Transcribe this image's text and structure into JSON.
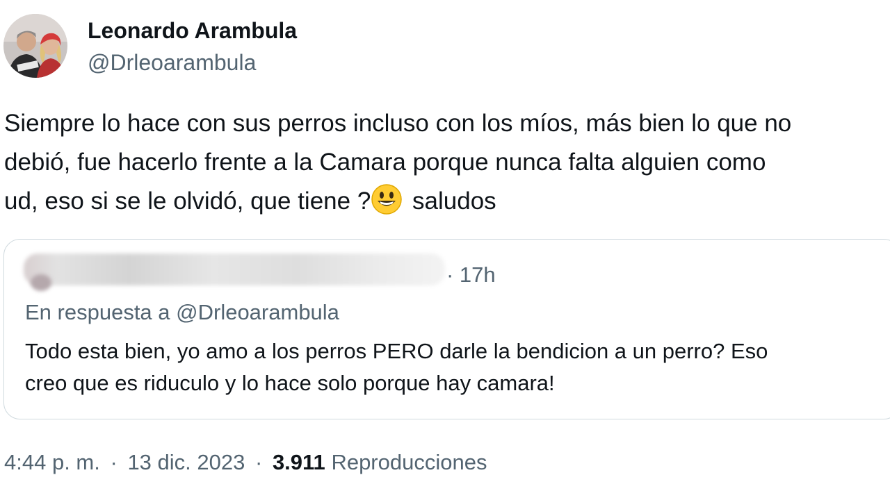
{
  "author": {
    "display_name": "Leonardo Arambula",
    "handle": "@Drleoarambula",
    "avatar_icon": "profile-photo-avatar"
  },
  "tweet": {
    "lines": [
      "Siempre lo hace con sus perros incluso con los míos, más bien lo que no",
      "debió,  fue hacerlo frente a la Camara porque nunca falta alguien como",
      "ud, eso si se le olvidó,  que tiene ?",
      " saludos"
    ],
    "emoji_icon": "grinning-face-emoji"
  },
  "quote": {
    "time": "· 17h",
    "reply_to": "En respuesta a @Drleoarambula",
    "lines": [
      "Todo esta bien, yo amo a los perros PERO darle la bendicion a un perro? Eso",
      "creo que es riduculo y lo hace solo porque hay camara!"
    ]
  },
  "meta": {
    "time": "4:44 p. m.",
    "separator": "·",
    "date": "13 dic. 2023",
    "views_count": "3.911",
    "views_label": "Reproducciones"
  },
  "colors": {
    "text_primary": "#0f1419",
    "text_secondary": "#536471",
    "border": "#cfd9de",
    "emoji_yellow": "#ffcc33"
  }
}
